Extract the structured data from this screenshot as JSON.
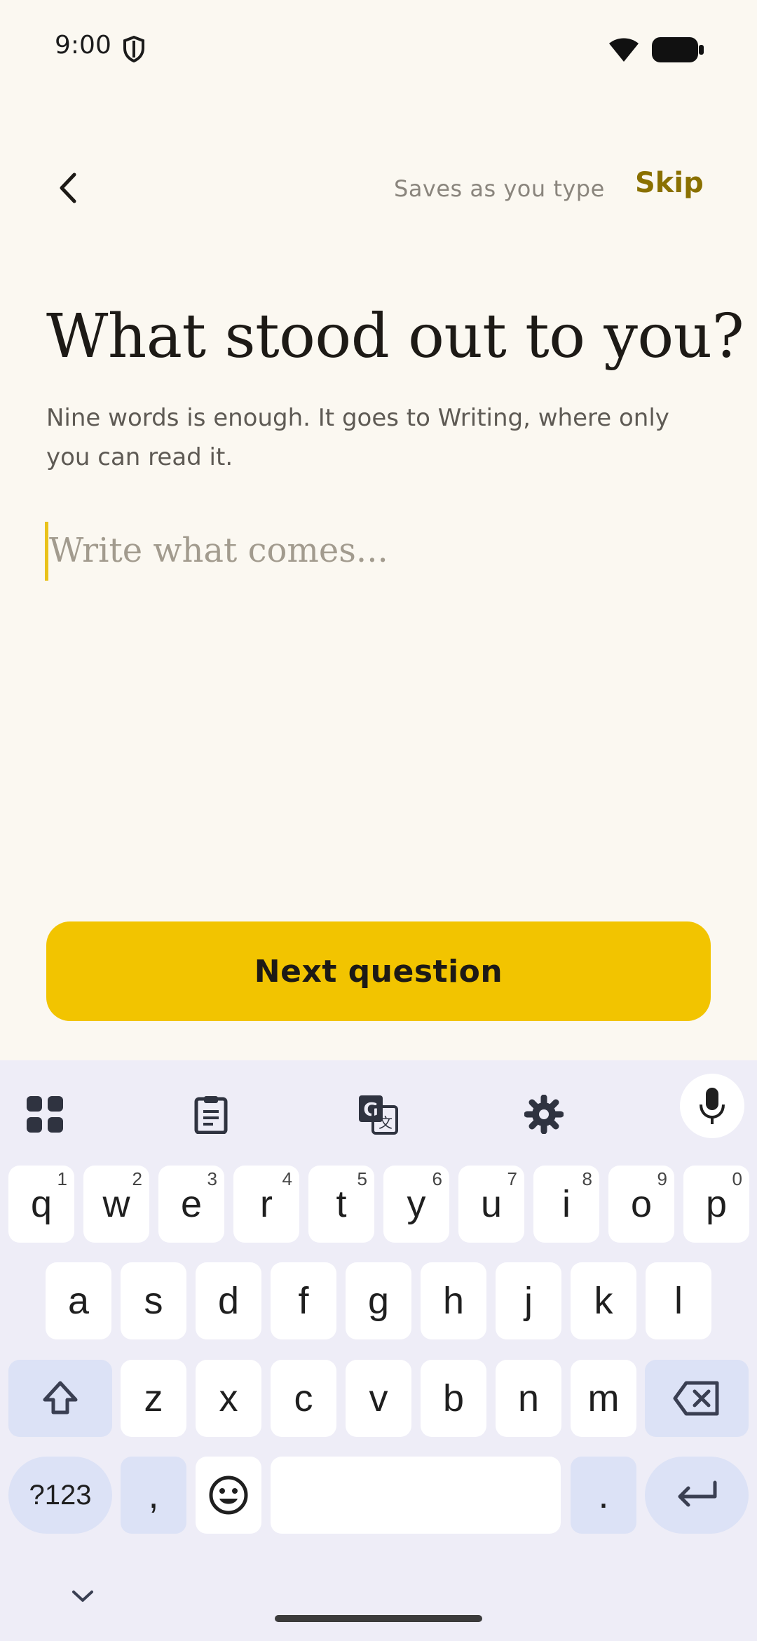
{
  "status_bar": {
    "time": "9:00"
  },
  "header": {
    "save_status": "Saves as you type",
    "skip_label": "Skip"
  },
  "question": {
    "title": "What stood out to you?",
    "subtitle": "Nine words is enough. It goes to Writing, where only you can read it."
  },
  "answer": {
    "value": "",
    "placeholder": "Write what comes..."
  },
  "primary_button": {
    "label": "Next question"
  },
  "keyboard": {
    "row1": [
      {
        "key": "q",
        "hint": "1"
      },
      {
        "key": "w",
        "hint": "2"
      },
      {
        "key": "e",
        "hint": "3"
      },
      {
        "key": "r",
        "hint": "4"
      },
      {
        "key": "t",
        "hint": "5"
      },
      {
        "key": "y",
        "hint": "6"
      },
      {
        "key": "u",
        "hint": "7"
      },
      {
        "key": "i",
        "hint": "8"
      },
      {
        "key": "o",
        "hint": "9"
      },
      {
        "key": "p",
        "hint": "0"
      }
    ],
    "row2": [
      "a",
      "s",
      "d",
      "f",
      "g",
      "h",
      "j",
      "k",
      "l"
    ],
    "row3": [
      "z",
      "x",
      "c",
      "v",
      "b",
      "n",
      "m"
    ],
    "symbols_label": "?123",
    "comma_label": ",",
    "period_label": ".",
    "toolbar_icons": [
      "apps-grid-icon",
      "clipboard-icon",
      "translate-icon",
      "settings-gear-icon",
      "microphone-icon"
    ],
    "accent_color": "#DCE2F6"
  },
  "colors": {
    "background": "#FBF8F1",
    "primary": "#F2C400",
    "skip": "#8a7000",
    "cursor": "#E9C21B"
  }
}
